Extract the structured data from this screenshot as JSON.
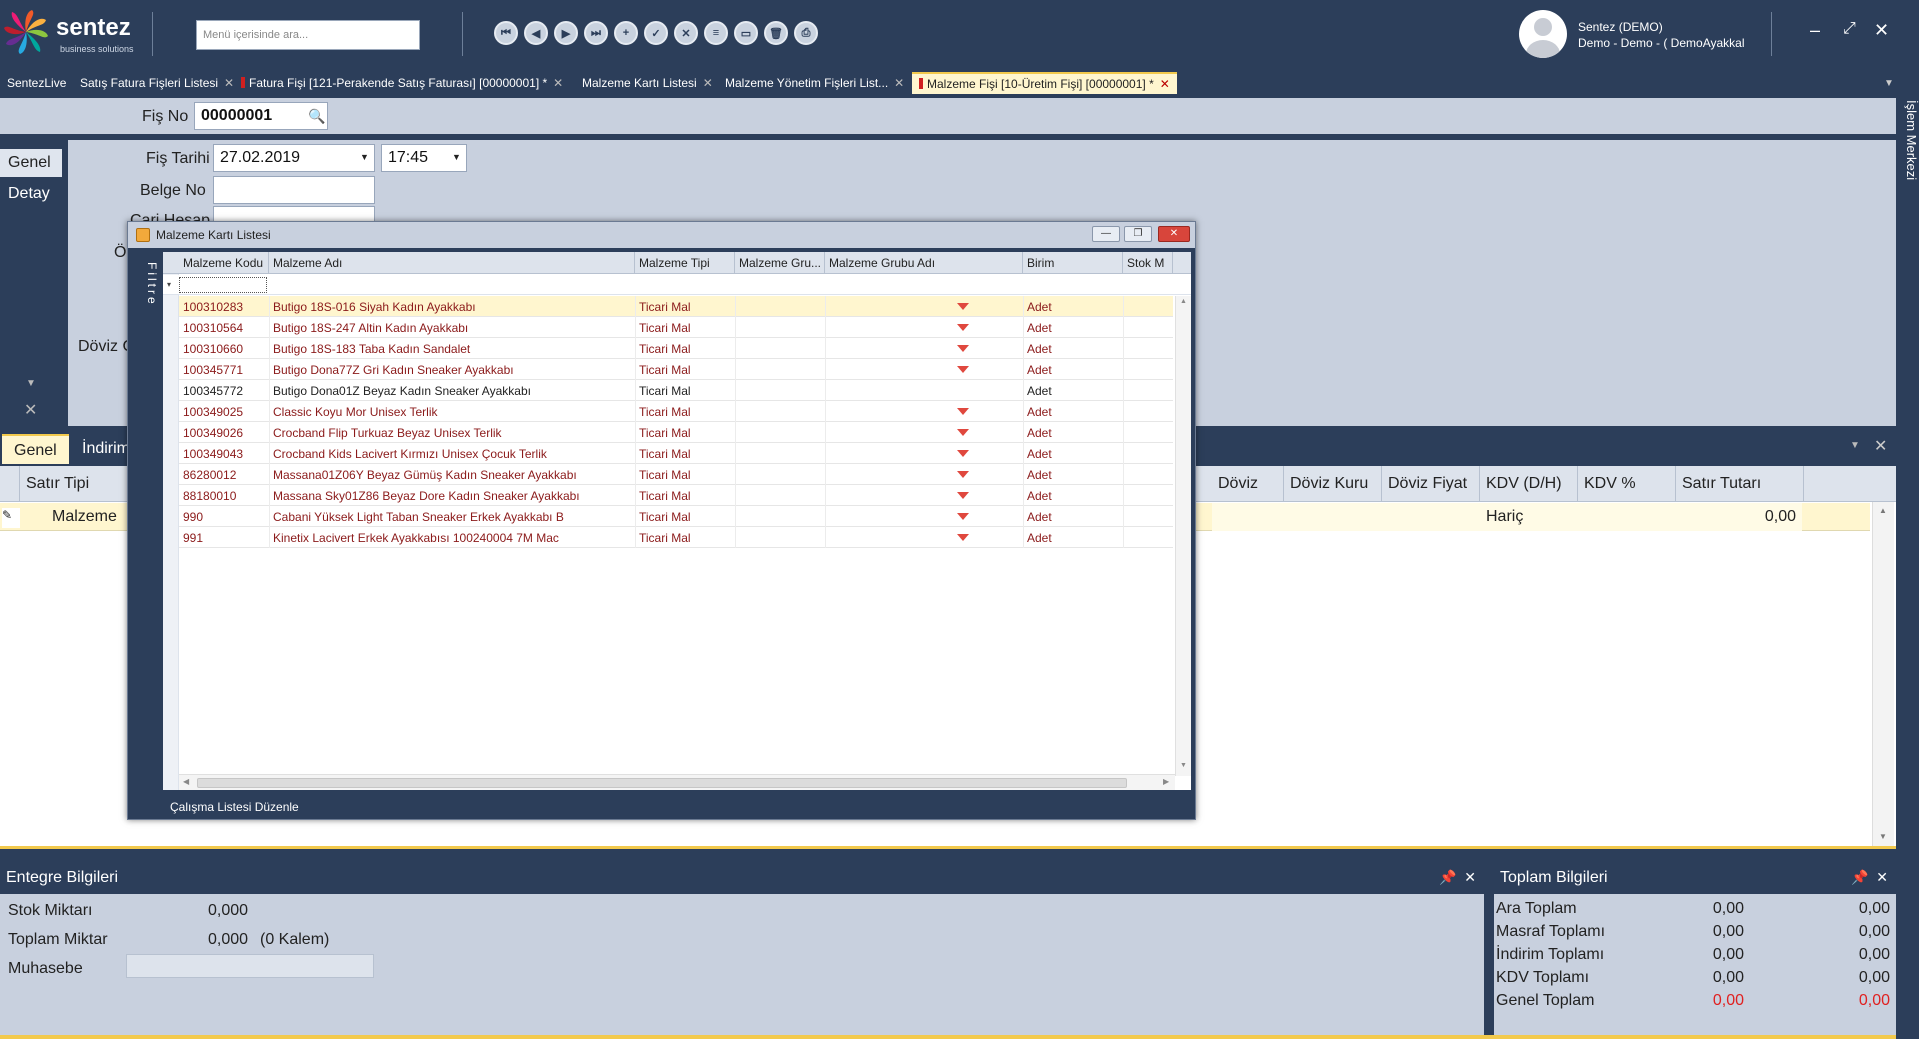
{
  "app": {
    "brand": "sentez",
    "brand_sub": "business solutions",
    "search_placeholder": "Menü içerisinde ara...",
    "user_name": "Sentez (DEMO)",
    "user_company": "Demo - Demo - ( DemoAyakkal",
    "side_panel": "İşlem Merkezi",
    "accent": "#f2c94c",
    "bg": "#2c3e5a"
  },
  "tabs": [
    {
      "label": "SentezLive",
      "closable": false,
      "flag": false
    },
    {
      "label": "Satış Fatura Fişleri Listesi",
      "closable": true,
      "flag": false
    },
    {
      "label": "Fatura Fişi [121-Perakende Satış Faturası] [00000001]  *",
      "closable": true,
      "flag": true
    },
    {
      "label": "Malzeme Kartı Listesi",
      "closable": true,
      "flag": false
    },
    {
      "label": "Malzeme Yönetim Fişleri List...",
      "closable": true,
      "flag": false
    },
    {
      "label": "Malzeme Fişi [10-Üretim Fişi]  [00000001]  *",
      "closable": true,
      "flag": true
    }
  ],
  "header": {
    "fis_no_label": "Fiş No",
    "fis_no_value": "00000001",
    "fis_tarihi_label": "Fiş Tarihi",
    "fis_tarihi_value": "27.02.2019",
    "time_value": "17:45",
    "belge_no_label": "Belge No",
    "cari_hesap_label": "Cari Hesap",
    "o_label": "Ö",
    "doviz_label": "Döviz C"
  },
  "leftnav": [
    "Genel",
    "Detay"
  ],
  "detail_tabs": [
    "Genel",
    "İndirim"
  ],
  "grid": {
    "left_cols": [
      "Satır Tipi"
    ],
    "right_cols": [
      "Döviz",
      "Döviz Kuru",
      "Döviz Fiyat",
      "KDV (D/H)",
      "KDV %",
      "Satır Tutarı"
    ],
    "row": {
      "satir_tipi": "Malzeme",
      "kdv_dh": "Hariç",
      "satir_tutari": "0,00"
    }
  },
  "dialog": {
    "title": "Malzeme Kartı Listesi",
    "filter_label": "Filtre",
    "footer_link": "Çalışma Listesi Düzenle",
    "columns": [
      "Malzeme Kodu",
      "Malzeme Adı",
      "Malzeme Tipi",
      "Malzeme Gru...",
      "Malzeme Grubu Adı",
      "Birim",
      "Stok M"
    ],
    "rows": [
      {
        "kod": "100310283",
        "ad": "Butigo 18S-016 Siyah Kadın Ayakkabı",
        "tip": "Ticari Mal",
        "birim": "Adet",
        "stock": true
      },
      {
        "kod": "100310564",
        "ad": "Butigo 18S-247 Altin Kadın Ayakkabı",
        "tip": "Ticari Mal",
        "birim": "Adet",
        "stock": true
      },
      {
        "kod": "100310660",
        "ad": "Butigo 18S-183 Taba Kadın Sandalet",
        "tip": "Ticari Mal",
        "birim": "Adet",
        "stock": true
      },
      {
        "kod": "100345771",
        "ad": "Butigo Dona77Z Gri Kadın Sneaker Ayakkabı",
        "tip": "Ticari Mal",
        "birim": "Adet",
        "stock": true
      },
      {
        "kod": "100345772",
        "ad": "Butigo Dona01Z Beyaz Kadın Sneaker Ayakkabı",
        "tip": "Ticari Mal",
        "birim": "Adet",
        "stock": false
      },
      {
        "kod": "100349025",
        "ad": "Classic Koyu Mor Unisex Terlik",
        "tip": "Ticari Mal",
        "birim": "Adet",
        "stock": true
      },
      {
        "kod": "100349026",
        "ad": "Crocband Flip Turkuaz Beyaz Unisex Terlik",
        "tip": "Ticari Mal",
        "birim": "Adet",
        "stock": true
      },
      {
        "kod": "100349043",
        "ad": "Crocband Kids Lacivert Kırmızı Unisex Çocuk Terlik",
        "tip": "Ticari Mal",
        "birim": "Adet",
        "stock": true
      },
      {
        "kod": "86280012",
        "ad": "Massana01Z06Y Beyaz Gümüş Kadın Sneaker Ayakkabı",
        "tip": "Ticari Mal",
        "birim": "Adet",
        "stock": true
      },
      {
        "kod": "88180010",
        "ad": "Massana Sky01Z86 Beyaz Dore Kadın Sneaker Ayakkabı",
        "tip": "Ticari Mal",
        "birim": "Adet",
        "stock": true
      },
      {
        "kod": "990",
        "ad": "Cabani Yüksek Light Taban Sneaker Erkek Ayakkabı B",
        "tip": "Ticari Mal",
        "birim": "Adet",
        "stock": true
      },
      {
        "kod": "991",
        "ad": "Kinetix Lacivert Erkek Ayakkabısı 100240004 7M Mac",
        "tip": "Ticari Mal",
        "birim": "Adet",
        "stock": true
      }
    ]
  },
  "entegre": {
    "title": "Entegre Bilgileri",
    "stok_label": "Stok Miktarı",
    "stok_value": "0,000",
    "toplam_label": "Toplam Miktar",
    "toplam_value": "0,000",
    "kalem": "(0 Kalem)",
    "muhasebe_label": "Muhasebe"
  },
  "toplam": {
    "title": "Toplam Bilgileri",
    "rows": [
      {
        "label": "Ara Toplam",
        "v1": "0,00",
        "v2": "0,00"
      },
      {
        "label": "Masraf Toplamı",
        "v1": "0,00",
        "v2": "0,00"
      },
      {
        "label": "İndirim Toplamı",
        "v1": "0,00",
        "v2": "0,00"
      },
      {
        "label": "KDV Toplamı",
        "v1": "0,00",
        "v2": "0,00"
      },
      {
        "label": "Genel Toplam",
        "v1": "0,00",
        "v2": "0,00",
        "red": true
      }
    ]
  }
}
